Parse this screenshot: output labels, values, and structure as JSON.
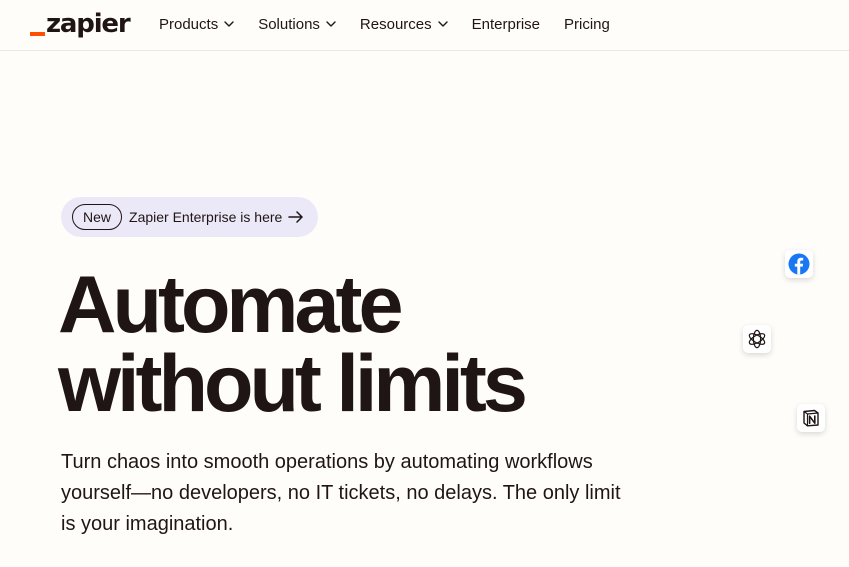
{
  "brand": {
    "logo_text": "zapier",
    "accent_color": "#ff4f00",
    "text_color": "#201515",
    "background": "#fffdf9"
  },
  "nav": {
    "items": [
      {
        "label": "Products",
        "has_dropdown": true
      },
      {
        "label": "Solutions",
        "has_dropdown": true
      },
      {
        "label": "Resources",
        "has_dropdown": true
      },
      {
        "label": "Enterprise",
        "has_dropdown": false
      },
      {
        "label": "Pricing",
        "has_dropdown": false
      }
    ]
  },
  "announcement": {
    "badge": "New",
    "text": "Zapier Enterprise is here",
    "icon": "arrow-right-icon"
  },
  "hero": {
    "headline_line1": "Automate",
    "headline_line2": "without limits",
    "subtext": "Turn chaos into smooth operations by automating workflows yourself—no developers, no IT tickets, no delays. The only limit is your imagination."
  },
  "app_icons": [
    {
      "name": "facebook-icon",
      "color": "#1877f2"
    },
    {
      "name": "openai-icon",
      "color": "#201515"
    },
    {
      "name": "notion-icon",
      "color": "#201515"
    }
  ]
}
